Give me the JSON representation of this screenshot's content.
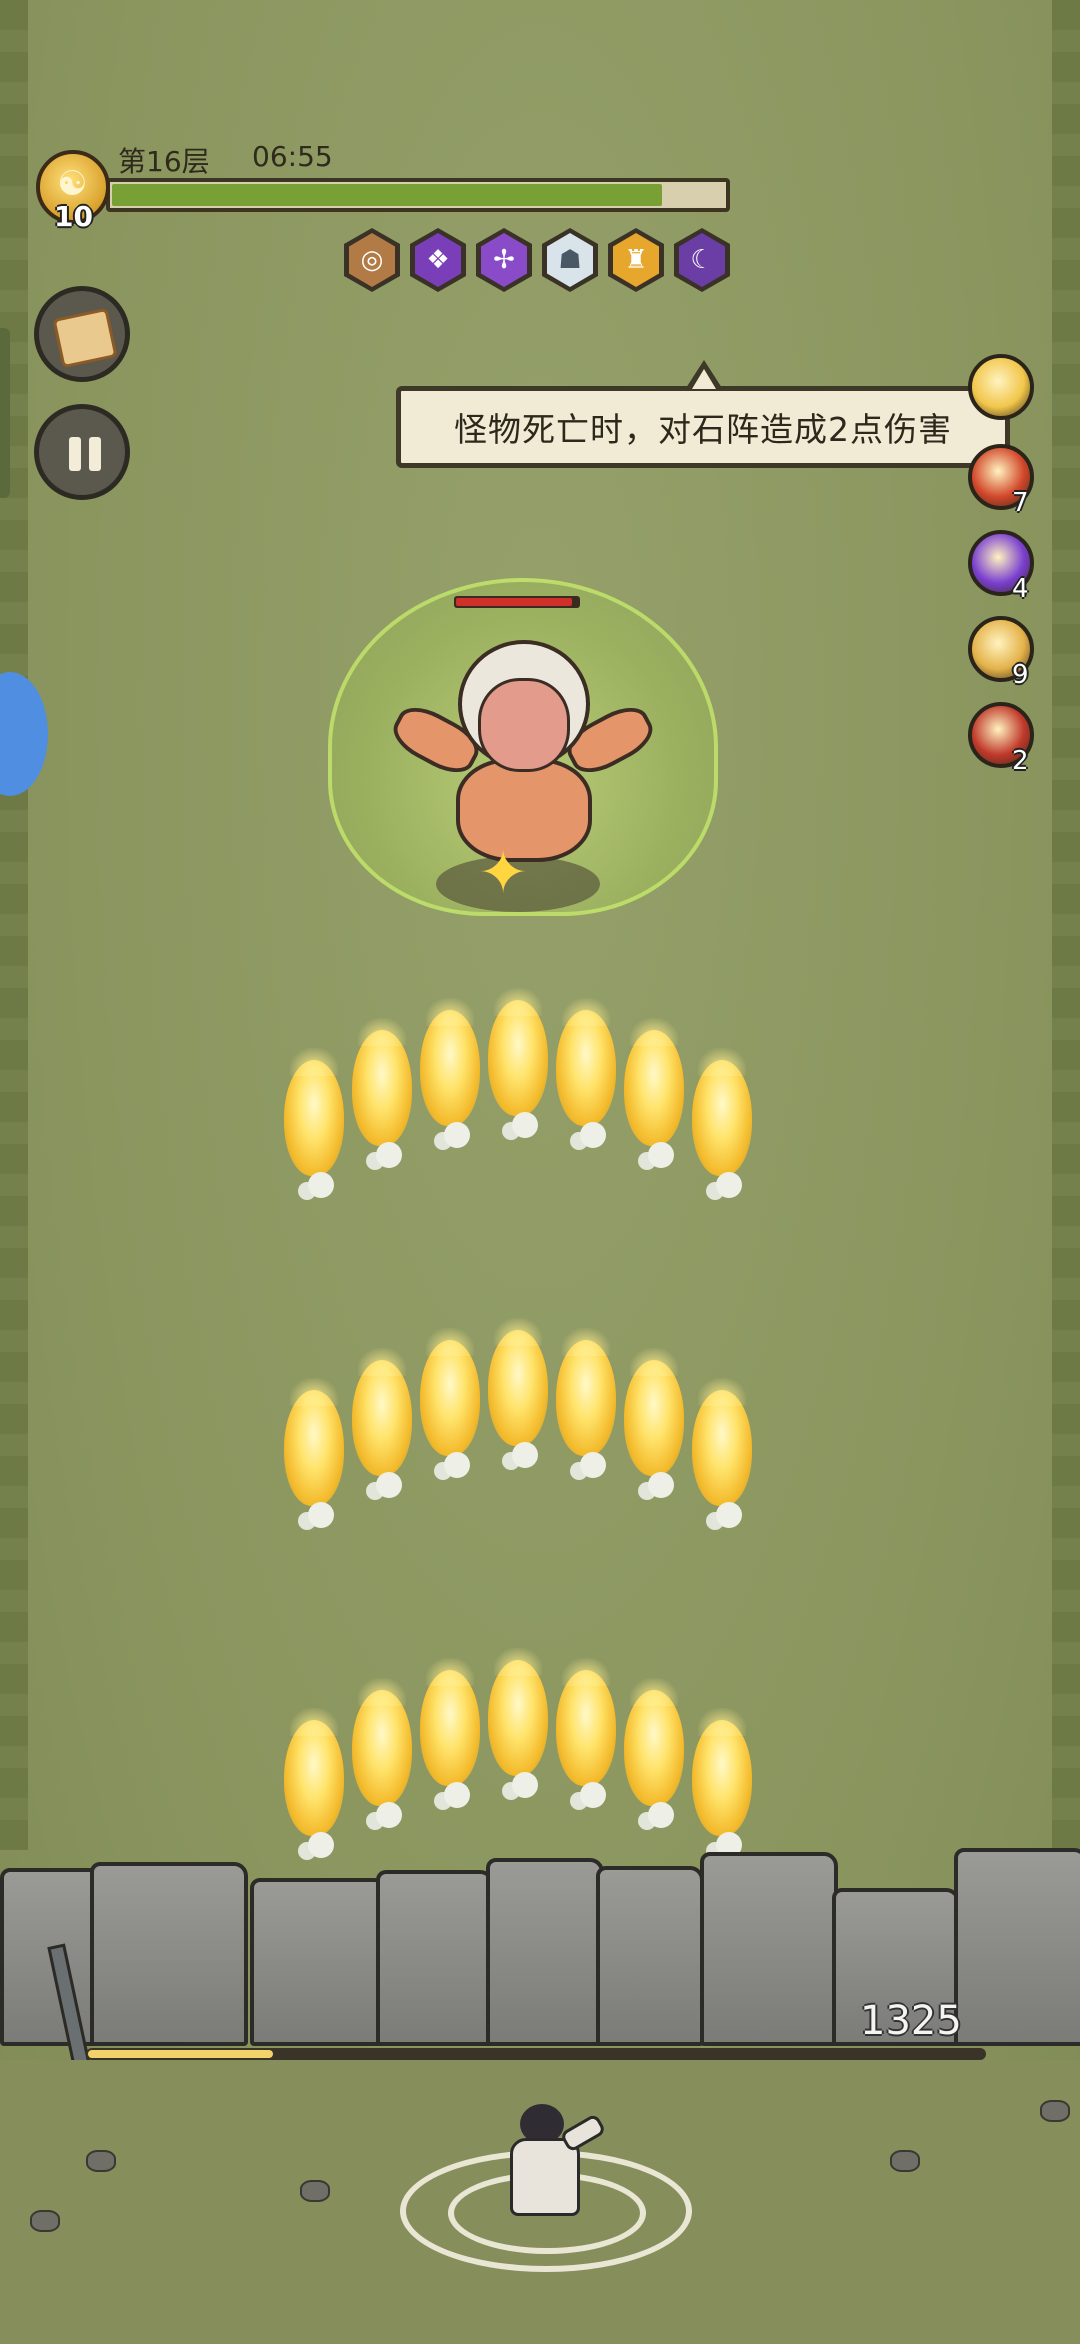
{
  "hud": {
    "player_level": "10",
    "floor": "第16层",
    "timer": "06:55",
    "progress": 0.9
  },
  "skills": [
    {
      "icon": "whirl-icon",
      "bg": "#b27a45"
    },
    {
      "icon": "demon-icon",
      "bg": "#7a3fb8"
    },
    {
      "icon": "spirit-icon",
      "bg": "#8a4bc8"
    },
    {
      "icon": "ghost-icon",
      "bg": "#d9e3ea"
    },
    {
      "icon": "warrior-icon",
      "bg": "#e6a72c"
    },
    {
      "icon": "shadow-icon",
      "bg": "#6b3ea6"
    }
  ],
  "tooltip": {
    "text": "怪物死亡时，对石阵造成2点伤害"
  },
  "buffs": [
    {
      "icon": "blast-icon",
      "count": "",
      "color": "#f1c64a"
    },
    {
      "icon": "flame-icon",
      "count": "7",
      "color": "#d2472a"
    },
    {
      "icon": "lightning-icon",
      "count": "4",
      "color": "#7a3fd0"
    },
    {
      "icon": "compass-icon",
      "count": "9",
      "color": "#e4b24a"
    },
    {
      "icon": "fire-slash-icon",
      "count": "2",
      "color": "#c0392b"
    }
  ],
  "boss": {
    "health": 0.95
  },
  "wall": {
    "hp_value": "1325",
    "hp_fraction": 0.21
  }
}
